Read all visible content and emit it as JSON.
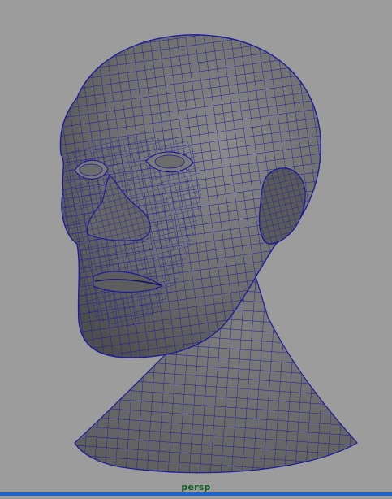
{
  "viewport": {
    "camera_name": "persp",
    "background_color": "#9c9c9c",
    "mesh_shade_color": "#6a6a6a",
    "wireframe_color": "#1a1a8e",
    "active_border_color": "#1f64c8",
    "label_color": "#0b5a1c",
    "object": "head-mesh"
  }
}
